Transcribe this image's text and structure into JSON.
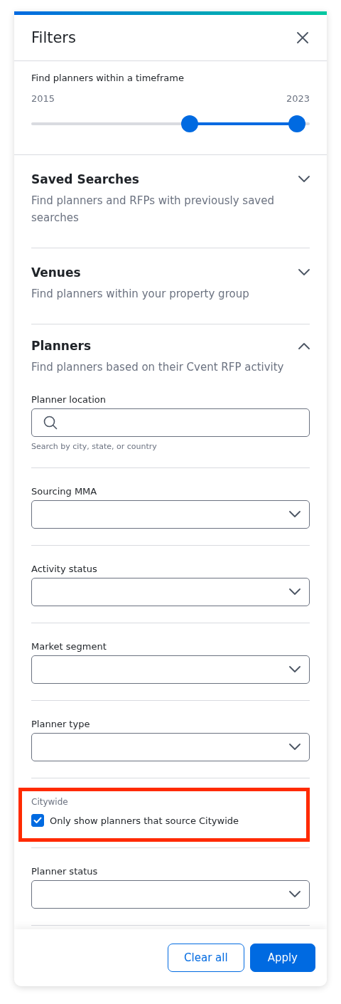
{
  "header": {
    "title": "Filters"
  },
  "timeframe": {
    "label": "Find planners within a timeframe",
    "min_label": "2015",
    "max_label": "2023",
    "thumbs": [
      {
        "level": 0.57
      },
      {
        "level": 0.955
      }
    ]
  },
  "sections": [
    {
      "title": "Saved Searches",
      "description": "Find planners and RFPs with previously saved searches",
      "expanded": false
    },
    {
      "title": "Venues",
      "description": "Find planners within your property group",
      "expanded": false
    },
    {
      "title": "Planners",
      "description": "Find planners based on their Cvent RFP activity",
      "expanded": true,
      "filters": [
        {
          "kind": "search",
          "label": "Planner location",
          "hint": "Search by city, state, or country"
        },
        {
          "kind": "select",
          "label": "Sourcing MMA"
        },
        {
          "kind": "select",
          "label": "Activity status"
        },
        {
          "kind": "select",
          "label": "Market segment"
        },
        {
          "kind": "select",
          "label": "Planner type"
        },
        {
          "kind": "checkbox",
          "label": "Citywide",
          "option": "Only show planners that source Citywide",
          "checked": true,
          "highlighted": true
        },
        {
          "kind": "select",
          "label": "Planner status"
        }
      ]
    }
  ],
  "footer": {
    "buttons": [
      {
        "label": "Clear all",
        "kind": "secondary"
      },
      {
        "label": "Apply",
        "kind": "primary"
      }
    ]
  }
}
